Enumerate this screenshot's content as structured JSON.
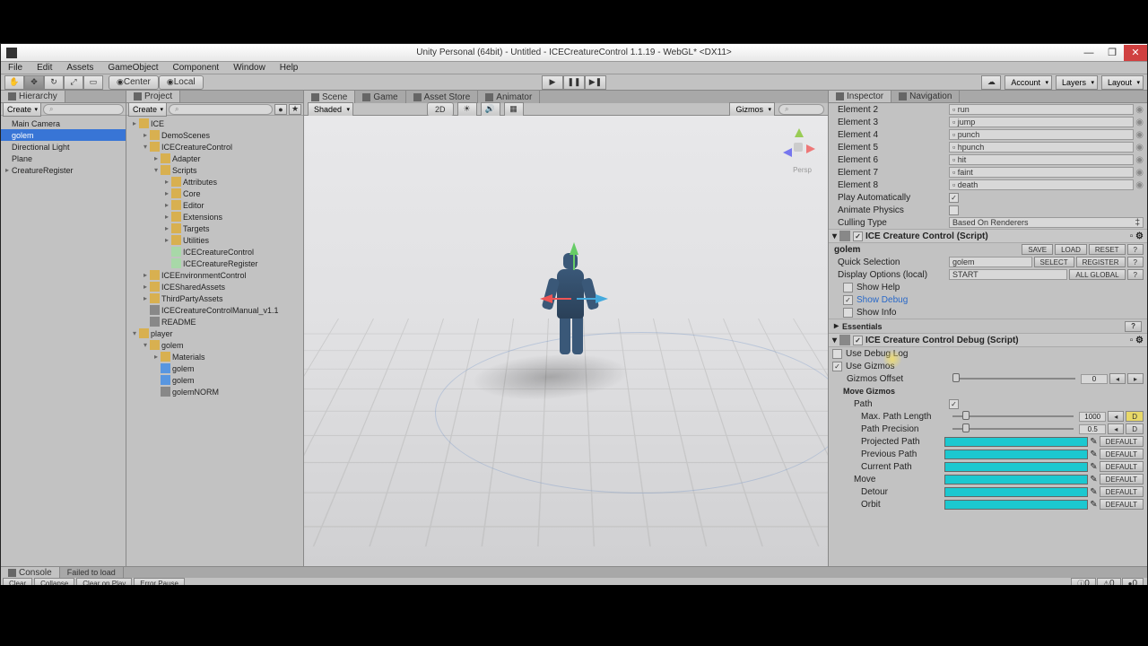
{
  "window": {
    "title": "Unity Personal (64bit) - Untitled - ICECreatureControl 1.1.19 - WebGL* <DX11>",
    "minimize": "—",
    "maximize": "❐",
    "close": "✕"
  },
  "menu": [
    "File",
    "Edit",
    "Assets",
    "GameObject",
    "Component",
    "Window",
    "Help"
  ],
  "toolbar": {
    "center": "Center",
    "local": "Local",
    "play": "▶",
    "pause": "❚❚",
    "step": "▶❚",
    "account": "Account",
    "layers": "Layers",
    "layout": "Layout"
  },
  "hierarchy": {
    "title": "Hierarchy",
    "create": "Create",
    "search_ph": "All",
    "items": [
      "Main Camera",
      "golem",
      "Directional Light",
      "Plane",
      "CreatureRegister"
    ],
    "selected_index": 1
  },
  "project": {
    "title": "Project",
    "create": "Create",
    "tree": [
      {
        "d": 0,
        "t": "ICE",
        "f": true
      },
      {
        "d": 1,
        "t": "DemoScenes",
        "f": true
      },
      {
        "d": 1,
        "t": "ICECreatureControl",
        "f": true,
        "open": true
      },
      {
        "d": 2,
        "t": "Adapter",
        "f": true
      },
      {
        "d": 2,
        "t": "Scripts",
        "f": true,
        "open": true
      },
      {
        "d": 3,
        "t": "Attributes",
        "f": true
      },
      {
        "d": 3,
        "t": "Core",
        "f": true
      },
      {
        "d": 3,
        "t": "Editor",
        "f": true
      },
      {
        "d": 3,
        "t": "Extensions",
        "f": true
      },
      {
        "d": 3,
        "t": "Targets",
        "f": true
      },
      {
        "d": 3,
        "t": "Utilities",
        "f": true
      },
      {
        "d": 3,
        "t": "ICECreatureControl",
        "s": true
      },
      {
        "d": 3,
        "t": "ICECreatureRegister",
        "s": true
      },
      {
        "d": 1,
        "t": "ICEEnvironmentControl",
        "f": true
      },
      {
        "d": 1,
        "t": "ICESharedAssets",
        "f": true
      },
      {
        "d": 1,
        "t": "ThirdPartyAssets",
        "f": true
      },
      {
        "d": 1,
        "t": "ICECreatureControlManual_v1.1"
      },
      {
        "d": 1,
        "t": "README"
      },
      {
        "d": 0,
        "t": "player",
        "f": true,
        "open": true
      },
      {
        "d": 1,
        "t": "golem",
        "f": true,
        "open": true
      },
      {
        "d": 2,
        "t": "Materials",
        "f": true
      },
      {
        "d": 2,
        "t": "golem",
        "p": true
      },
      {
        "d": 2,
        "t": "golem",
        "p": true
      },
      {
        "d": 2,
        "t": "golemNORM"
      }
    ]
  },
  "scene": {
    "tabs": [
      "Scene",
      "Game",
      "Asset Store",
      "Animator"
    ],
    "shaded": "Shaded",
    "mode2d": "2D",
    "gizmos": "Gizmos",
    "persp": "Persp"
  },
  "inspector": {
    "tabs": [
      "Inspector",
      "Navigation"
    ],
    "elements": [
      {
        "label": "Element 2",
        "val": "run"
      },
      {
        "label": "Element 3",
        "val": "jump"
      },
      {
        "label": "Element 4",
        "val": "punch"
      },
      {
        "label": "Element 5",
        "val": "hpunch"
      },
      {
        "label": "Element 6",
        "val": "hit"
      },
      {
        "label": "Element 7",
        "val": "faint"
      },
      {
        "label": "Element 8",
        "val": "death"
      }
    ],
    "play_auto": "Play Automatically",
    "anim_physics": "Animate Physics",
    "culling": "Culling Type",
    "culling_val": "Based On Renderers",
    "comp1": "ICE Creature Control (Script)",
    "obj_name": "golem",
    "btns": {
      "save": "SAVE",
      "load": "LOAD",
      "reset": "RESET"
    },
    "quick_sel": "Quick Selection",
    "quick_val": "golem",
    "select": "SELECT",
    "register": "REGISTER",
    "disp_opts": "Display Options (local)",
    "disp_val": "START",
    "all_global": "ALL GLOBAL",
    "show_help": "Show Help",
    "show_debug": "Show Debug",
    "show_info": "Show Info",
    "essentials": "Essentials",
    "comp2": "ICE Creature Control Debug (Script)",
    "use_debug_log": "Use Debug Log",
    "use_gizmos": "Use Gizmos",
    "gizmos_offset": "Gizmos Offset",
    "offset_val": "0",
    "move_gizmos": "Move Gizmos",
    "path": "Path",
    "max_path": "Max. Path Length",
    "max_path_val": "1000",
    "path_prec": "Path Precision",
    "path_prec_val": "0.5",
    "proj_path": "Projected Path",
    "prev_path": "Previous Path",
    "curr_path": "Current Path",
    "move": "Move",
    "detour": "Detour",
    "orbit": "Orbit",
    "default": "DEFAULT",
    "d_btn": "D"
  },
  "console": {
    "tab": "Console",
    "failed": "Failed to load",
    "btns": [
      "Clear",
      "Collapse",
      "Clear on Play",
      "Error Pause"
    ],
    "counts": [
      "0",
      "0",
      "0"
    ]
  }
}
